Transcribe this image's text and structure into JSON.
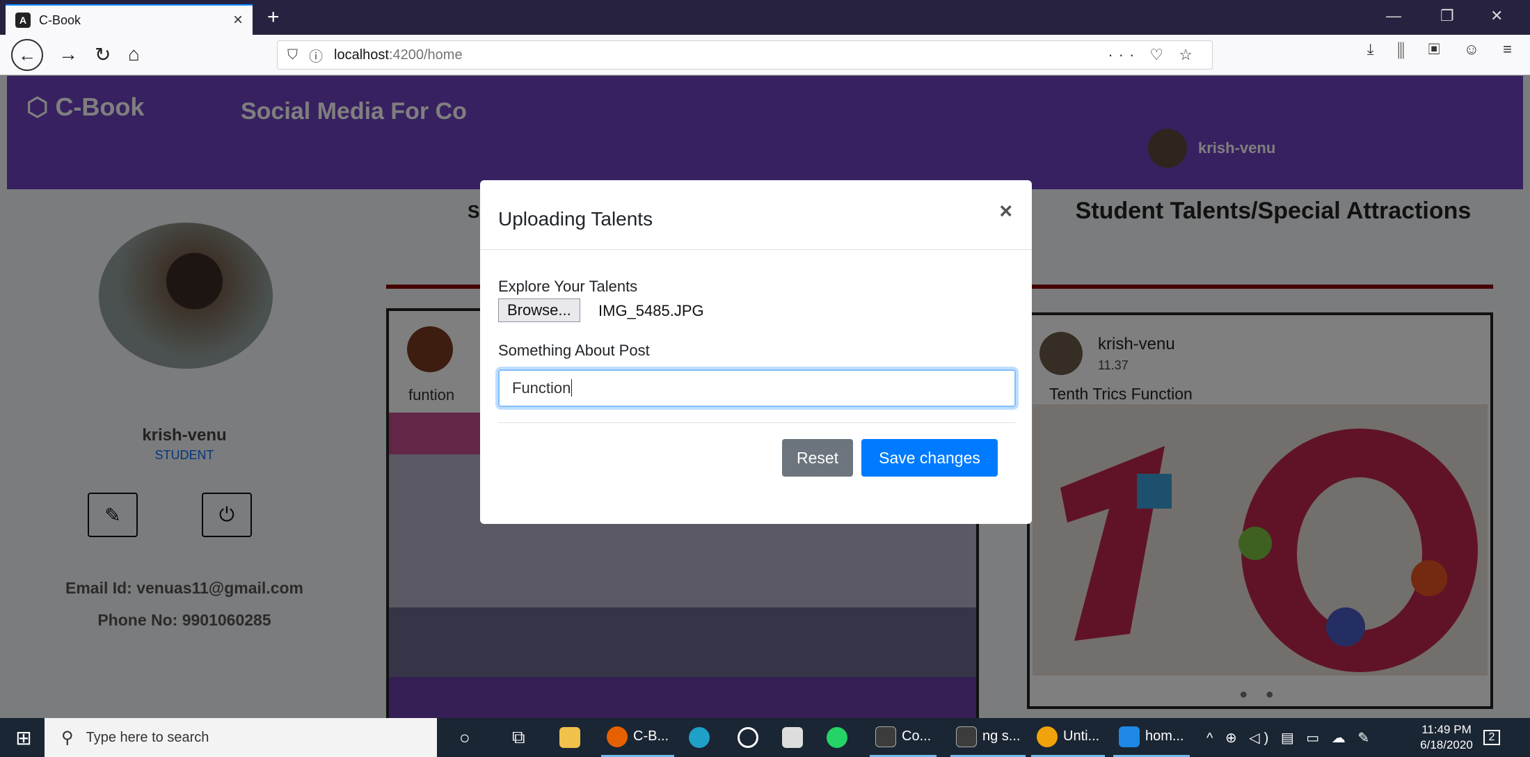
{
  "browser": {
    "tab_title": "C-Book",
    "tab_close": "×",
    "new_tab": "+",
    "url_host": "localhost",
    "url_path": ":4200/home",
    "nav_back": "←",
    "nav_forward": "→",
    "nav_reload": "↻",
    "nav_home": "⌂",
    "url_right_icons": "··· ♡ ☆",
    "toolbar_right_icons": "⤓ ⫼ ▣ ☺ ≡",
    "win_minimize": "—",
    "win_restore": "❐",
    "win_close": "✕"
  },
  "header": {
    "brand": "C-Book",
    "brand_icon": "cube-icon",
    "tagline": "Social Media For Co",
    "username": "krish-venu"
  },
  "sidebar": {
    "name": "krish-venu",
    "role": "STUDENT",
    "edit_icon": "✎",
    "power_icon": "⏻",
    "email": "Email Id: venuas11@gmail.com",
    "phone": "Phone No: 9901060285"
  },
  "feed": {
    "title": "Sc",
    "post_caption": "funtion"
  },
  "talents": {
    "title": "Student Talents/Special Attractions",
    "user": "krish-venu",
    "time": "11.37",
    "caption": "Tenth Trics Function",
    "dots": "● ●"
  },
  "modal": {
    "title": "Uploading Talents",
    "close": "×",
    "file_label": "Explore Your Talents",
    "browse_label": "Browse...",
    "file_name": "IMG_5485.JPG",
    "post_label": "Something About Post",
    "post_value": "Function",
    "reset_label": "Reset",
    "save_label": "Save changes"
  },
  "taskbar": {
    "start_icon": "⊞",
    "search_placeholder": "Type here to search",
    "cortana": "○",
    "taskview": "⧉",
    "apps": [
      {
        "label": "C-B...",
        "color": "#e66000"
      },
      {
        "label": "Co...",
        "color": "#3c3c3c"
      },
      {
        "label": "ng s...",
        "color": "#3c3c3c"
      },
      {
        "label": "Unti...",
        "color": "#f0a30a"
      },
      {
        "label": "hom...",
        "color": "#1e88e5"
      }
    ],
    "tray": "^ ⊕ ◁) ▤ ▭ ☁ ✎",
    "time": "11:49 PM",
    "date": "6/18/2020",
    "notification_count": "2"
  },
  "colors": {
    "header_bg": "#6f42c1",
    "accent_blue": "#007bff",
    "reset_gray": "#6c757d",
    "rule_red": "#8b0000"
  }
}
